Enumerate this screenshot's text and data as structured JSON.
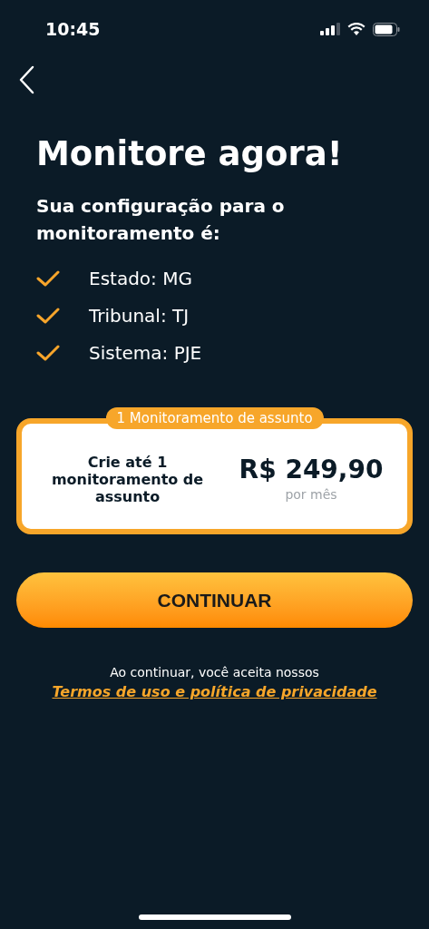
{
  "status_bar": {
    "time": "10:45"
  },
  "title": "Monitore agora!",
  "subtitle": "Sua configuração para o monitoramento é:",
  "config": [
    {
      "label": "Estado: MG",
      "checked": true
    },
    {
      "label": "Tribunal: TJ",
      "checked": true
    },
    {
      "label": "Sistema: PJE",
      "checked": true
    }
  ],
  "plan": {
    "badge": "1 Monitoramento de assunto",
    "description": "Crie até 1 monitoramento de assunto",
    "price": "R$ 249,90",
    "period": "por mês",
    "selected": true
  },
  "continue_button": "CONTINUAR",
  "terms": {
    "text": "Ao continuar, você aceita nossos",
    "link": "Termos de uso e política de privacidade"
  }
}
